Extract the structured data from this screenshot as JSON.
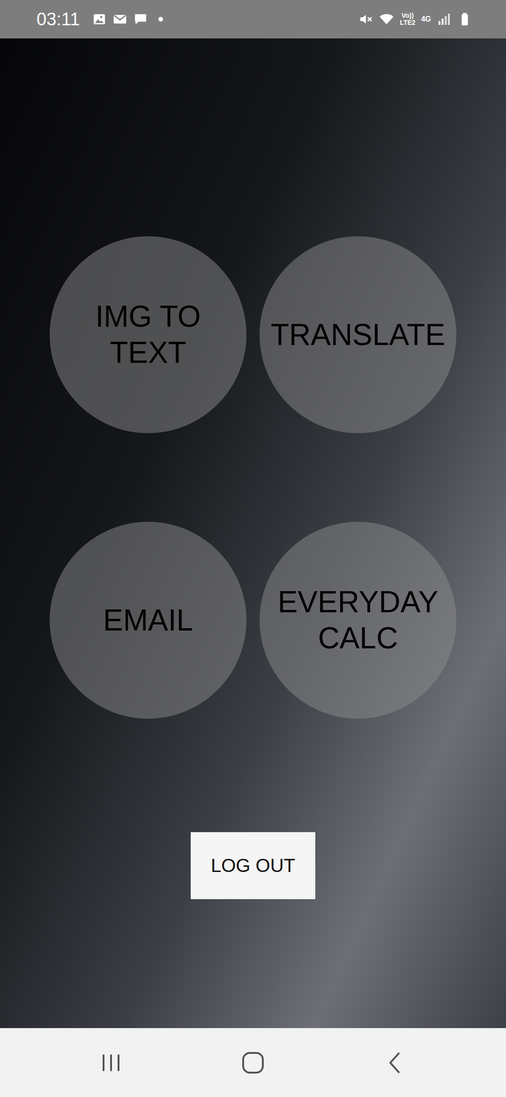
{
  "status_bar": {
    "time": "03:11",
    "volte": "Vo))",
    "lte": "LTE2",
    "network": "4G"
  },
  "menu": [
    {
      "label": "IMG TO TEXT"
    },
    {
      "label": "TRANSLATE"
    },
    {
      "label": "EMAIL"
    },
    {
      "label": "EVERYDAY CALC"
    }
  ],
  "logout_button": {
    "label": "LOG OUT"
  }
}
